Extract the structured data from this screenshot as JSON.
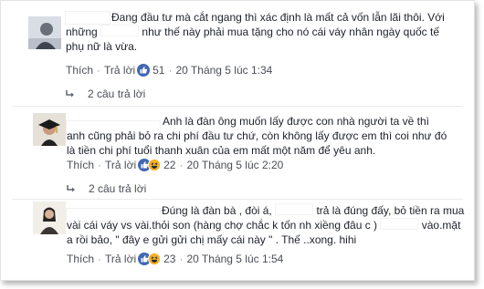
{
  "comments": [
    {
      "text_lines": [
        "Đang đầu tư mà cắt ngang thì xác định là mất cả vốn lẫn lãi thôi. Với",
        "những",
        "như thế này phải mua tặng cho nó cái váy nhân ngày quốc tế",
        "phụ nữ là vừa."
      ],
      "like_label": "Thích",
      "reply_label": "Trả lời",
      "reaction_icons": [
        "like-icon"
      ],
      "reaction_count": "51",
      "timestamp": "20 Tháng 5 lúc 1:34",
      "replies_label": "2 câu trả lời"
    },
    {
      "text_lines": [
        "Anh là đàn ông muốn lấy được con nhà người ta về thì",
        "anh cũng phải bỏ ra chi phí đầu tư chứ, còn không lấy được em thì coi như đó",
        "là tiền chi phí tuổi thanh xuân của em mất một năm để yêu anh."
      ],
      "like_label": "Thích",
      "reply_label": "Trả lời",
      "reaction_icons": [
        "like-icon",
        "haha-icon"
      ],
      "reaction_count": "22",
      "timestamp": "20 Tháng 5 lúc 2:20",
      "replies_label": "2 câu trả lời"
    },
    {
      "text_lines": [
        "Đúng là đàn bà , đòi á,",
        "trả là đúng đấy, bỏ tiền ra mua",
        "vài cái váy vs vài.thỏi son (hàng chợ chắc k tốn nh xiềng đâu c )",
        "vào.mặt",
        "a rồi bảo, \" đây e gửi gửi chị mấy cái này \" . Thế ..xong. hihi"
      ],
      "like_label": "Thích",
      "reply_label": "Trả lời",
      "reaction_icons": [
        "like-icon",
        "haha-icon"
      ],
      "reaction_count": "23",
      "timestamp": "20 Tháng 5 lúc 1:54"
    }
  ],
  "colors": {
    "like_blue": "#4267b2",
    "haha_yellow": "#f7b125",
    "meta_gray": "#90949c",
    "text": "#1d2129"
  }
}
